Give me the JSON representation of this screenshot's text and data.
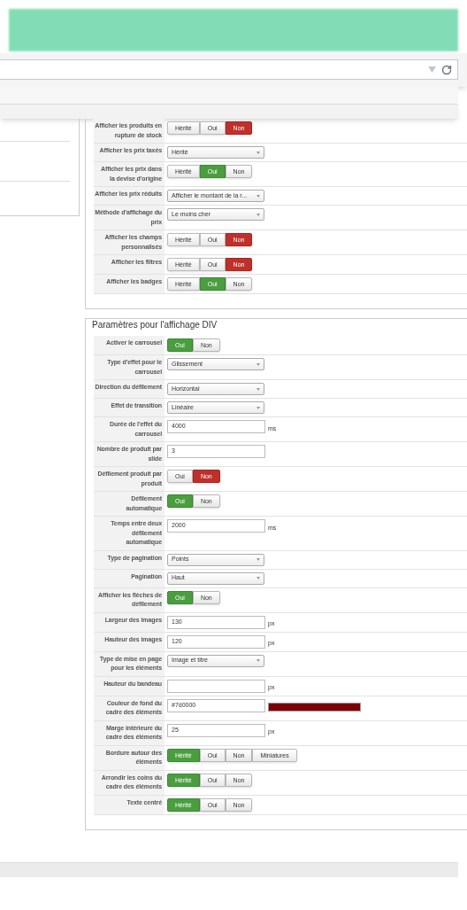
{
  "section1": {
    "rows": [
      {
        "label": "Afficher les produits en rupture de stock",
        "kind": "toggle",
        "options": [
          {
            "label": "Hérité",
            "selected": false,
            "kind": "positive"
          },
          {
            "label": "Oui",
            "selected": false,
            "kind": "positive"
          },
          {
            "label": "Non",
            "selected": true,
            "kind": "negative"
          }
        ]
      },
      {
        "label": "Afficher les prix taxés",
        "kind": "select",
        "value": "Hérité"
      },
      {
        "label": "Afficher les prix dans la devise d'origine",
        "kind": "toggle",
        "options": [
          {
            "label": "Hérité",
            "selected": false,
            "kind": "positive"
          },
          {
            "label": "Oui",
            "selected": true,
            "kind": "positive"
          },
          {
            "label": "Non",
            "selected": false,
            "kind": "negative"
          }
        ]
      },
      {
        "label": "Afficher les prix réduits",
        "kind": "select",
        "value": "Afficher le montant de la r..."
      },
      {
        "label": "Méthode d'affichage du prix",
        "kind": "select",
        "value": "Le moins cher"
      },
      {
        "label": "Afficher les champs personnalisés",
        "kind": "toggle",
        "options": [
          {
            "label": "Hérité",
            "selected": false,
            "kind": "positive"
          },
          {
            "label": "Oui",
            "selected": false,
            "kind": "positive"
          },
          {
            "label": "Non",
            "selected": true,
            "kind": "negative"
          }
        ]
      },
      {
        "label": "Afficher les filtres",
        "kind": "toggle",
        "options": [
          {
            "label": "Hérité",
            "selected": false,
            "kind": "positive"
          },
          {
            "label": "Oui",
            "selected": false,
            "kind": "positive"
          },
          {
            "label": "Non",
            "selected": true,
            "kind": "negative"
          }
        ]
      },
      {
        "label": "Afficher les badges",
        "kind": "toggle",
        "options": [
          {
            "label": "Hérité",
            "selected": false,
            "kind": "positive"
          },
          {
            "label": "Oui",
            "selected": true,
            "kind": "positive"
          },
          {
            "label": "Non",
            "selected": false,
            "kind": "negative"
          }
        ]
      }
    ]
  },
  "section2": {
    "legend": "Paramètres pour l'affichage DIV",
    "rows": [
      {
        "label": "Activer le carrousel",
        "kind": "toggle",
        "options": [
          {
            "label": "Oui",
            "selected": true,
            "kind": "positive"
          },
          {
            "label": "Non",
            "selected": false,
            "kind": "negative"
          }
        ]
      },
      {
        "label": "Type d'effet pour le carrousel",
        "kind": "select",
        "value": "Glissement"
      },
      {
        "label": "Direction du défilement",
        "kind": "select",
        "value": "Horizontal"
      },
      {
        "label": "Effet de transition",
        "kind": "select",
        "value": "Linéaire"
      },
      {
        "label": "Durée de l'effet du carrousel",
        "kind": "text",
        "value": "4000",
        "unit": "ms"
      },
      {
        "label": "Nombre de produit par slide",
        "kind": "text",
        "value": "3"
      },
      {
        "label": "Défilement produit par produit",
        "kind": "toggle",
        "options": [
          {
            "label": "Oui",
            "selected": false,
            "kind": "positive"
          },
          {
            "label": "Non",
            "selected": true,
            "kind": "negative"
          }
        ]
      },
      {
        "label": "Défilement automatique",
        "kind": "toggle",
        "options": [
          {
            "label": "Oui",
            "selected": true,
            "kind": "positive"
          },
          {
            "label": "Non",
            "selected": false,
            "kind": "negative"
          }
        ]
      },
      {
        "label": "Temps entre deux défilement automatique",
        "kind": "text",
        "value": "2000",
        "unit": "ms"
      },
      {
        "label": "Type de pagination",
        "kind": "select",
        "value": "Points"
      },
      {
        "label": "Pagination",
        "kind": "select",
        "value": "Haut"
      },
      {
        "label": "Afficher les flèches de défilement",
        "kind": "toggle",
        "options": [
          {
            "label": "Oui",
            "selected": true,
            "kind": "positive"
          },
          {
            "label": "Non",
            "selected": false,
            "kind": "negative"
          }
        ]
      },
      {
        "label": "Largeur des images",
        "kind": "text",
        "value": "130",
        "unit": "px"
      },
      {
        "label": "Hauteur des images",
        "kind": "text",
        "value": "120",
        "unit": "px"
      },
      {
        "label": "Type de mise en page pour les éléments",
        "kind": "select",
        "value": "Image et titre"
      },
      {
        "label": "Hauteur du bandeau",
        "kind": "text",
        "unit": "px"
      },
      {
        "label": "Couleur de fond du cadre des éléments",
        "kind": "color",
        "value": "#7d0000",
        "color": "#7d0000"
      },
      {
        "label": "Marge intérieure du cadre des éléments",
        "kind": "text",
        "value": "25",
        "unit": "px"
      },
      {
        "label": "Bordure autour des éléments",
        "kind": "toggle",
        "options": [
          {
            "label": "Hérité",
            "selected": true,
            "kind": "positive"
          },
          {
            "label": "Oui",
            "selected": false,
            "kind": "positive"
          },
          {
            "label": "Non",
            "selected": false,
            "kind": "negative"
          },
          {
            "label": "Miniatures",
            "selected": false,
            "kind": "positive"
          }
        ]
      },
      {
        "label": "Arrondir les coins du cadre des éléments",
        "kind": "toggle",
        "options": [
          {
            "label": "Hérité",
            "selected": true,
            "kind": "positive"
          },
          {
            "label": "Oui",
            "selected": false,
            "kind": "positive"
          },
          {
            "label": "Non",
            "selected": false,
            "kind": "negative"
          }
        ]
      },
      {
        "label": "Texte centré",
        "kind": "toggle",
        "options": [
          {
            "label": "Hérité",
            "selected": true,
            "kind": "positive"
          },
          {
            "label": "Oui",
            "selected": false,
            "kind": "positive"
          },
          {
            "label": "Non",
            "selected": false,
            "kind": "negative"
          }
        ]
      }
    ]
  }
}
